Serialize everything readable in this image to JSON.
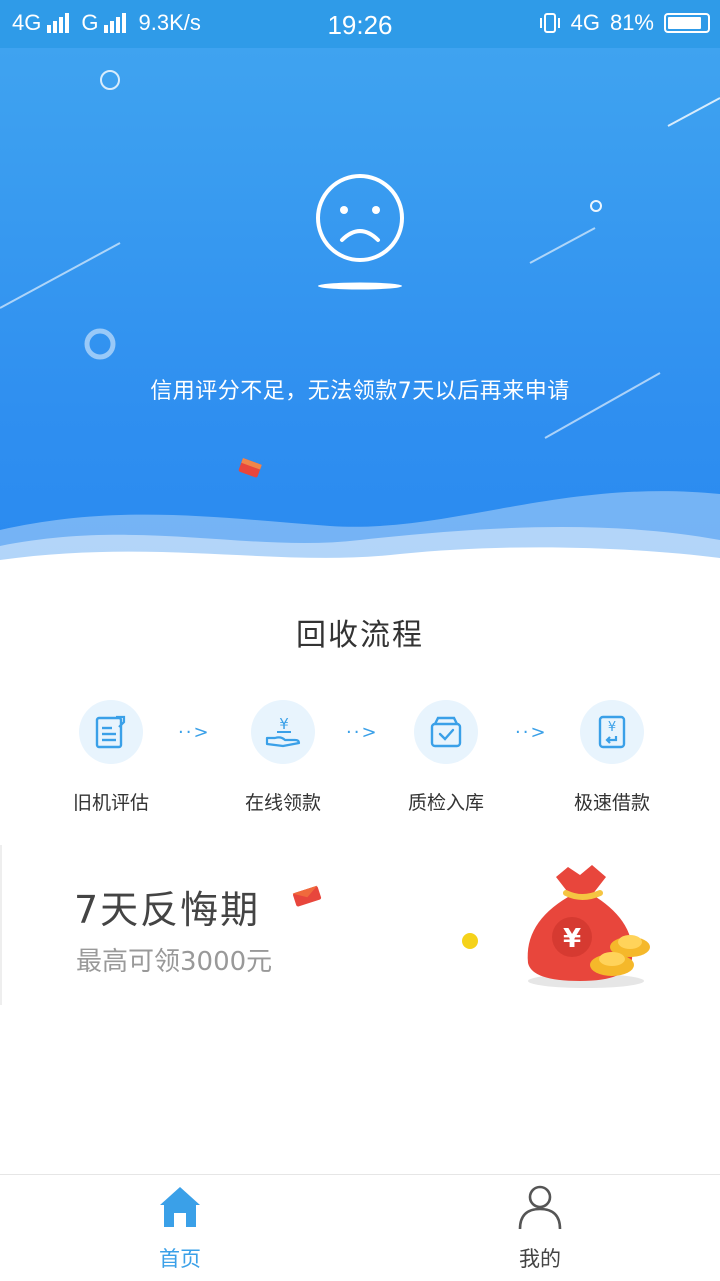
{
  "status_bar": {
    "network_left": "4G",
    "network_left2": "G",
    "speed": "9.3K/s",
    "time": "19:26",
    "network_right": "4G",
    "battery": "81%"
  },
  "hero": {
    "message": "信用评分不足，无法领款7天以后再来申请",
    "icon": "sad-face-icon"
  },
  "process": {
    "title": "回收流程",
    "steps": [
      {
        "label": "旧机评估",
        "icon": "document-edit-icon"
      },
      {
        "label": "在线领款",
        "icon": "hand-money-icon"
      },
      {
        "label": "质检入库",
        "icon": "box-check-icon"
      },
      {
        "label": "极速借款",
        "icon": "fast-loan-icon"
      }
    ],
    "arrow_text": "··>"
  },
  "promo": {
    "title": "7天反悔期",
    "subtitle": "最高可领3000元",
    "icon": "money-bag-icon"
  },
  "tabbar": {
    "tabs": [
      {
        "label": "首页",
        "icon": "home-icon",
        "active": true
      },
      {
        "label": "我的",
        "icon": "user-icon",
        "active": false
      }
    ]
  },
  "colors": {
    "primary": "#2f8ff0",
    "accent_blue": "#3aa0e8",
    "bag_red": "#e8463c",
    "gold": "#f5b82a"
  }
}
